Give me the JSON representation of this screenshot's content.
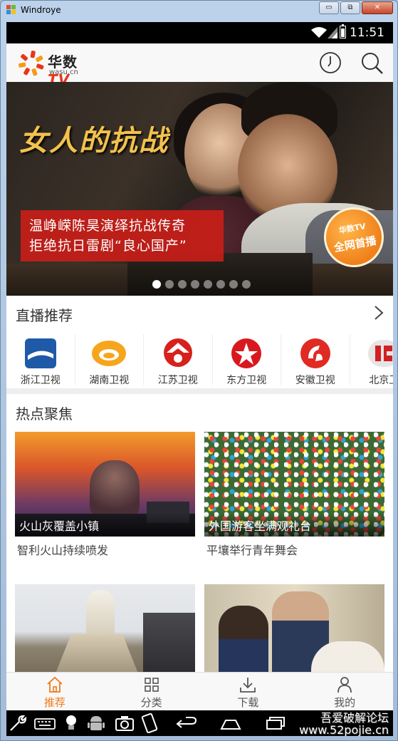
{
  "window": {
    "title": "Windroye",
    "minimize": "▭",
    "restore": "⧉",
    "close": "✕"
  },
  "status_bar": {
    "time": "11:51"
  },
  "app": {
    "logo_brand": "华数",
    "logo_tv": "TV",
    "logo_domain": "wasu.cn"
  },
  "banner": {
    "title": "女人的抗战",
    "caption_line1": "温峥嵘陈昊演绎抗战传奇",
    "caption_line2": "拒绝抗日雷剧“良心国产”",
    "badge_brand": "华数TV",
    "badge_text": "全网首播",
    "slide_count": 8,
    "active_slide": 0
  },
  "live": {
    "title": "直播推荐",
    "channels": [
      {
        "name": "浙江卫视",
        "icon": "zhejiang-tv-logo"
      },
      {
        "name": "湖南卫视",
        "icon": "hunan-tv-logo"
      },
      {
        "name": "江苏卫视",
        "icon": "jiangsu-tv-logo"
      },
      {
        "name": "东方卫视",
        "icon": "dragon-tv-logo"
      },
      {
        "name": "安徽卫视",
        "icon": "anhui-tv-logo"
      },
      {
        "name": "北京卫",
        "icon": "beijing-tv-logo"
      }
    ]
  },
  "hot": {
    "title": "热点聚焦",
    "items": [
      {
        "overlay": "火山灰覆盖小镇",
        "subtitle": "智利火山持续喷发"
      },
      {
        "overlay": "外国游客坐满观礼台",
        "subtitle": "平壤举行青年舞会"
      },
      {
        "overlay": "",
        "subtitle": ""
      },
      {
        "overlay": "",
        "subtitle": ""
      }
    ]
  },
  "tabs": [
    {
      "label": "推荐",
      "icon": "home-icon",
      "active": true
    },
    {
      "label": "分类",
      "icon": "grid-icon",
      "active": false
    },
    {
      "label": "下载",
      "icon": "download-icon",
      "active": false
    },
    {
      "label": "我的",
      "icon": "user-icon",
      "active": false
    }
  ],
  "watermark": {
    "line1": "吾爱破解论坛",
    "line2": "www.52pojie.cn"
  },
  "colors": {
    "accent": "#f07a16",
    "banner_caption": "#c81e18",
    "status_bar": "#000000"
  }
}
